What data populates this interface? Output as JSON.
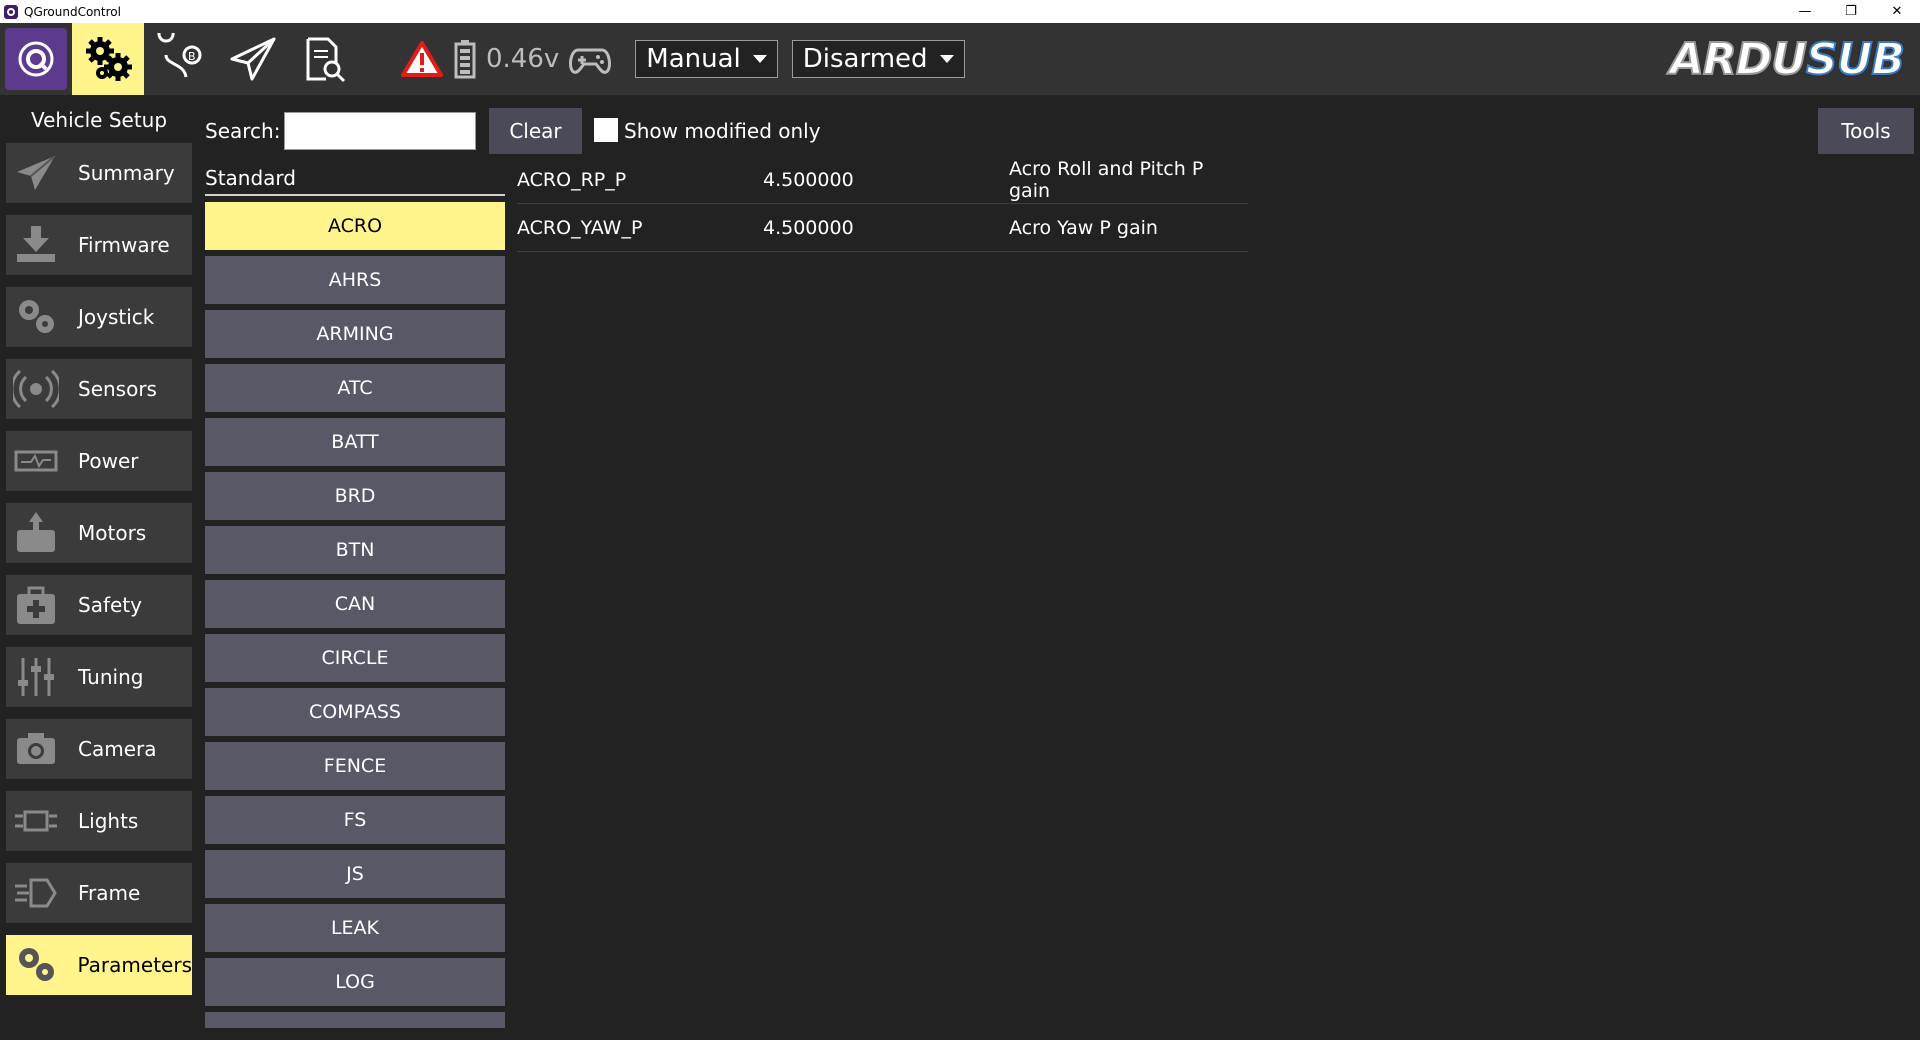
{
  "window": {
    "title": "QGroundControl",
    "minimize": "—",
    "restore": "❐",
    "close": "✕"
  },
  "toolbar": {
    "battery_voltage": "0.46v",
    "flight_mode": "Manual",
    "arm_state": "Disarmed",
    "brand_part1": "ARDU",
    "brand_part2": "SUB",
    "warning_color": "#e21b1b",
    "active_color": "#fff58c"
  },
  "sidebar": {
    "heading": "Vehicle Setup",
    "items": [
      {
        "label": "Summary",
        "icon": "paper-plane-icon"
      },
      {
        "label": "Firmware",
        "icon": "download-icon"
      },
      {
        "label": "Joystick",
        "icon": "gears-icon"
      },
      {
        "label": "Sensors",
        "icon": "radio-waves-icon"
      },
      {
        "label": "Power",
        "icon": "power-icon"
      },
      {
        "label": "Motors",
        "icon": "motor-icon"
      },
      {
        "label": "Safety",
        "icon": "first-aid-icon"
      },
      {
        "label": "Tuning",
        "icon": "sliders-icon"
      },
      {
        "label": "Camera",
        "icon": "camera-icon"
      },
      {
        "label": "Lights",
        "icon": "lights-icon"
      },
      {
        "label": "Frame",
        "icon": "frame-icon"
      },
      {
        "label": "Parameters",
        "icon": "gears-icon",
        "active": true
      }
    ]
  },
  "search": {
    "label": "Search:",
    "value": "",
    "clear_label": "Clear",
    "modified_only_label": "Show modified only",
    "tools_label": "Tools"
  },
  "groups": {
    "header": "Standard",
    "items": [
      "ACRO",
      "AHRS",
      "ARMING",
      "ATC",
      "BATT",
      "BRD",
      "BTN",
      "CAN",
      "CIRCLE",
      "COMPASS",
      "FENCE",
      "FS",
      "JS",
      "LEAK",
      "LOG",
      ""
    ],
    "selected": "ACRO"
  },
  "params": [
    {
      "name": "ACRO_RP_P",
      "value": "4.500000",
      "description": "Acro Roll and Pitch P gain"
    },
    {
      "name": "ACRO_YAW_P",
      "value": "4.500000",
      "description": "Acro Yaw P gain"
    }
  ]
}
